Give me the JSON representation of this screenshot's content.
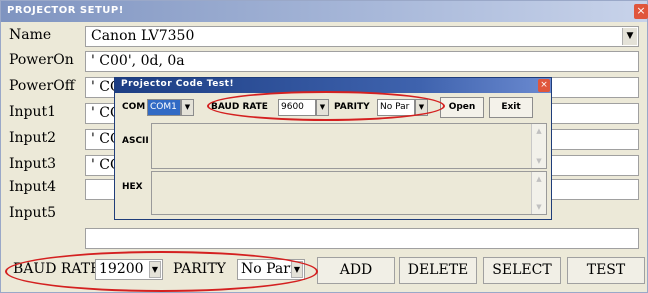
{
  "window": {
    "title": "PROJECTOR SETUP!",
    "close_glyph": "×"
  },
  "rows": [
    {
      "label": "Name",
      "value": "Canon LV7350",
      "has_dropdown": true
    },
    {
      "label": "PowerOn",
      "value": "' C00', 0d, 0a"
    },
    {
      "label": "PowerOff",
      "value": "' CO"
    },
    {
      "label": "Input1",
      "value": "' CO"
    },
    {
      "label": "Input2",
      "value": "' CO"
    },
    {
      "label": "Input3",
      "value": "' CO"
    },
    {
      "label": "Input4",
      "value": ""
    },
    {
      "label": "Input5",
      "value": ""
    }
  ],
  "bottom": {
    "baud_label": "BAUD RATE",
    "baud_value": "19200",
    "parity_label": "PARITY",
    "parity_value": "No Pari",
    "add": "ADD",
    "delete": "DELETE",
    "select": "SELECT",
    "test": "TEST"
  },
  "dialog": {
    "title": "Projector Code Test!",
    "close_glyph": "×",
    "com_label": "COM",
    "com_value": "COM1",
    "baud_label": "BAUD RATE",
    "baud_value": "9600",
    "parity_label": "PARITY",
    "parity_value": "No Par",
    "open": "Open",
    "exit": "Exit",
    "ascii_label": "ASCII",
    "hex_label": "HEX"
  },
  "colors": {
    "highlight_oval": "#d42020",
    "selected_bg": "#316ac5"
  },
  "icons": {
    "dropdown": "chevron-down-icon",
    "scroll_up": "scroll-up-arrow-icon",
    "scroll_down": "scroll-down-arrow-icon"
  }
}
